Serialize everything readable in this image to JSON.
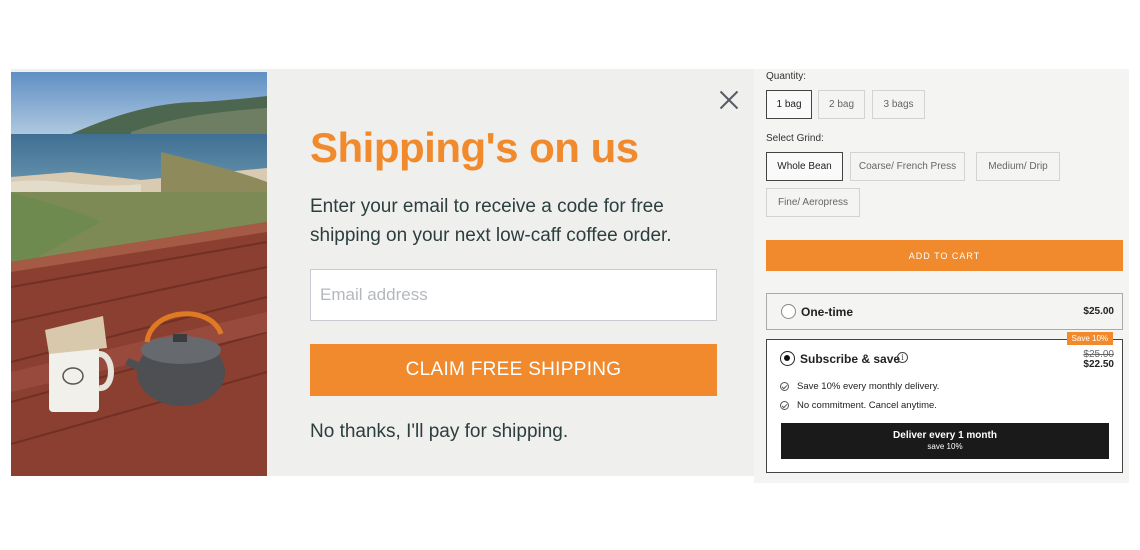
{
  "popup": {
    "headline": "Shipping's on us",
    "subtext": "Enter your email to receive a code for free shipping on your next low-caff coffee order.",
    "email_placeholder": "Email address",
    "email_value": "",
    "claim_button": "CLAIM FREE SHIPPING",
    "decline_link": "No thanks, I'll pay for shipping.",
    "close_icon": "close-icon",
    "image_subject": "ocean-coast-picnic-table-coffee-photo"
  },
  "product": {
    "quantity_label": "Quantity:",
    "quantity_options": [
      "1 bag",
      "2 bag",
      "3 bags"
    ],
    "quantity_selected": "1 bag",
    "grind_label": "Select Grind:",
    "grind_options": [
      "Whole Bean",
      "Coarse/ French Press",
      "Medium/ Drip",
      "Fine/ Aeropress"
    ],
    "grind_selected": "Whole Bean",
    "add_to_cart": "ADD TO CART",
    "one_time": {
      "label": "One-time",
      "price": "$25.00",
      "selected": false
    },
    "subscribe": {
      "label": "Subscribe & save",
      "badge": "Save 10%",
      "old_price": "$25.00",
      "new_price": "$22.50",
      "selected": true,
      "benefits": [
        "Save 10% every monthly delivery.",
        "No commitment. Cancel anytime."
      ],
      "deliver_button": "Deliver every 1 month",
      "deliver_sub": "save 10%"
    }
  },
  "colors": {
    "accent": "#f08a2c",
    "modal_bg": "#efefed",
    "text_dark": "#2c3e3e",
    "button_dark": "#1a1a1a"
  }
}
